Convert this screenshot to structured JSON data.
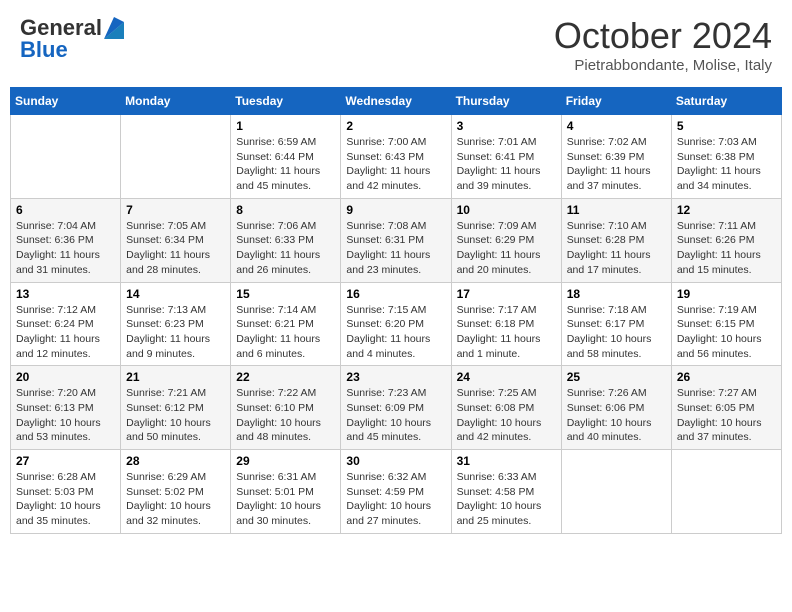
{
  "logo": {
    "general": "General",
    "blue": "Blue"
  },
  "title": "October 2024",
  "location": "Pietrabbondante, Molise, Italy",
  "days_of_week": [
    "Sunday",
    "Monday",
    "Tuesday",
    "Wednesday",
    "Thursday",
    "Friday",
    "Saturday"
  ],
  "weeks": [
    [
      {
        "day": null,
        "info": null
      },
      {
        "day": null,
        "info": null
      },
      {
        "day": "1",
        "info": "Sunrise: 6:59 AM\nSunset: 6:44 PM\nDaylight: 11 hours and 45 minutes."
      },
      {
        "day": "2",
        "info": "Sunrise: 7:00 AM\nSunset: 6:43 PM\nDaylight: 11 hours and 42 minutes."
      },
      {
        "day": "3",
        "info": "Sunrise: 7:01 AM\nSunset: 6:41 PM\nDaylight: 11 hours and 39 minutes."
      },
      {
        "day": "4",
        "info": "Sunrise: 7:02 AM\nSunset: 6:39 PM\nDaylight: 11 hours and 37 minutes."
      },
      {
        "day": "5",
        "info": "Sunrise: 7:03 AM\nSunset: 6:38 PM\nDaylight: 11 hours and 34 minutes."
      }
    ],
    [
      {
        "day": "6",
        "info": "Sunrise: 7:04 AM\nSunset: 6:36 PM\nDaylight: 11 hours and 31 minutes."
      },
      {
        "day": "7",
        "info": "Sunrise: 7:05 AM\nSunset: 6:34 PM\nDaylight: 11 hours and 28 minutes."
      },
      {
        "day": "8",
        "info": "Sunrise: 7:06 AM\nSunset: 6:33 PM\nDaylight: 11 hours and 26 minutes."
      },
      {
        "day": "9",
        "info": "Sunrise: 7:08 AM\nSunset: 6:31 PM\nDaylight: 11 hours and 23 minutes."
      },
      {
        "day": "10",
        "info": "Sunrise: 7:09 AM\nSunset: 6:29 PM\nDaylight: 11 hours and 20 minutes."
      },
      {
        "day": "11",
        "info": "Sunrise: 7:10 AM\nSunset: 6:28 PM\nDaylight: 11 hours and 17 minutes."
      },
      {
        "day": "12",
        "info": "Sunrise: 7:11 AM\nSunset: 6:26 PM\nDaylight: 11 hours and 15 minutes."
      }
    ],
    [
      {
        "day": "13",
        "info": "Sunrise: 7:12 AM\nSunset: 6:24 PM\nDaylight: 11 hours and 12 minutes."
      },
      {
        "day": "14",
        "info": "Sunrise: 7:13 AM\nSunset: 6:23 PM\nDaylight: 11 hours and 9 minutes."
      },
      {
        "day": "15",
        "info": "Sunrise: 7:14 AM\nSunset: 6:21 PM\nDaylight: 11 hours and 6 minutes."
      },
      {
        "day": "16",
        "info": "Sunrise: 7:15 AM\nSunset: 6:20 PM\nDaylight: 11 hours and 4 minutes."
      },
      {
        "day": "17",
        "info": "Sunrise: 7:17 AM\nSunset: 6:18 PM\nDaylight: 11 hours and 1 minute."
      },
      {
        "day": "18",
        "info": "Sunrise: 7:18 AM\nSunset: 6:17 PM\nDaylight: 10 hours and 58 minutes."
      },
      {
        "day": "19",
        "info": "Sunrise: 7:19 AM\nSunset: 6:15 PM\nDaylight: 10 hours and 56 minutes."
      }
    ],
    [
      {
        "day": "20",
        "info": "Sunrise: 7:20 AM\nSunset: 6:13 PM\nDaylight: 10 hours and 53 minutes."
      },
      {
        "day": "21",
        "info": "Sunrise: 7:21 AM\nSunset: 6:12 PM\nDaylight: 10 hours and 50 minutes."
      },
      {
        "day": "22",
        "info": "Sunrise: 7:22 AM\nSunset: 6:10 PM\nDaylight: 10 hours and 48 minutes."
      },
      {
        "day": "23",
        "info": "Sunrise: 7:23 AM\nSunset: 6:09 PM\nDaylight: 10 hours and 45 minutes."
      },
      {
        "day": "24",
        "info": "Sunrise: 7:25 AM\nSunset: 6:08 PM\nDaylight: 10 hours and 42 minutes."
      },
      {
        "day": "25",
        "info": "Sunrise: 7:26 AM\nSunset: 6:06 PM\nDaylight: 10 hours and 40 minutes."
      },
      {
        "day": "26",
        "info": "Sunrise: 7:27 AM\nSunset: 6:05 PM\nDaylight: 10 hours and 37 minutes."
      }
    ],
    [
      {
        "day": "27",
        "info": "Sunrise: 6:28 AM\nSunset: 5:03 PM\nDaylight: 10 hours and 35 minutes."
      },
      {
        "day": "28",
        "info": "Sunrise: 6:29 AM\nSunset: 5:02 PM\nDaylight: 10 hours and 32 minutes."
      },
      {
        "day": "29",
        "info": "Sunrise: 6:31 AM\nSunset: 5:01 PM\nDaylight: 10 hours and 30 minutes."
      },
      {
        "day": "30",
        "info": "Sunrise: 6:32 AM\nSunset: 4:59 PM\nDaylight: 10 hours and 27 minutes."
      },
      {
        "day": "31",
        "info": "Sunrise: 6:33 AM\nSunset: 4:58 PM\nDaylight: 10 hours and 25 minutes."
      },
      {
        "day": null,
        "info": null
      },
      {
        "day": null,
        "info": null
      }
    ]
  ]
}
